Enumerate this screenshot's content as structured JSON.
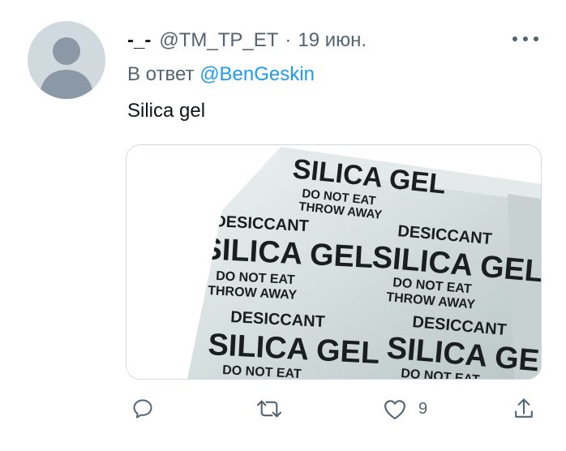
{
  "tweet": {
    "display_name": "-_-",
    "handle": "@TM_TP_ET",
    "separator": "·",
    "time": "19 июн.",
    "reply_prefix": "В ответ",
    "reply_to": "@BenGeskin",
    "text": "Silica gel"
  },
  "media": {
    "type": "photo",
    "print_lines": {
      "silica_gel": "SILICA GEL",
      "desiccant": "DESICCANT",
      "do_not_eat": "DO NOT EAT",
      "throw_away": "THROW AWAY"
    }
  },
  "actions": {
    "reply_icon": "reply-icon",
    "retweet_icon": "retweet-icon",
    "like_icon": "heart-icon",
    "like_count": "9",
    "share_icon": "share-icon"
  },
  "colors": {
    "accent": "#1d9bf0",
    "secondary_text": "#536471",
    "avatar_bg": "#cfd9de"
  }
}
